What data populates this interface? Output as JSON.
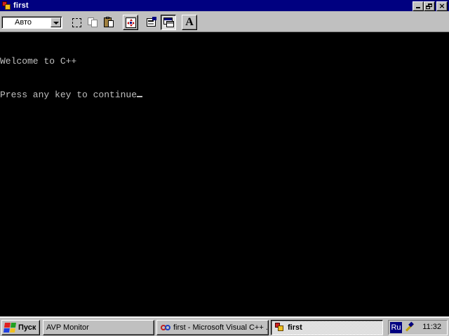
{
  "window": {
    "title": "first",
    "colors": {
      "titlebar": "#000080",
      "console_bg": "#000000",
      "console_fg": "#c0c0c0"
    }
  },
  "toolbar": {
    "font_select_value": "Авто",
    "buttons": [
      {
        "icon": "mark-icon"
      },
      {
        "icon": "copy-icon"
      },
      {
        "icon": "paste-icon"
      },
      {
        "icon": "fullscreen-icon"
      },
      {
        "icon": "properties-icon"
      },
      {
        "icon": "background-icon"
      },
      {
        "icon": "font-icon",
        "glyph": "A"
      }
    ]
  },
  "console": {
    "lines": [
      "Welcome to C++",
      "Press any key to continue"
    ]
  },
  "taskbar": {
    "start_label": "Пуск",
    "tasks": [
      {
        "label": "AVP Monitor"
      },
      {
        "label": "first - Microsoft Visual C++ ..."
      },
      {
        "label": "first",
        "active": true
      }
    ],
    "tray": {
      "language": "Ru",
      "clock": "11:32"
    }
  }
}
